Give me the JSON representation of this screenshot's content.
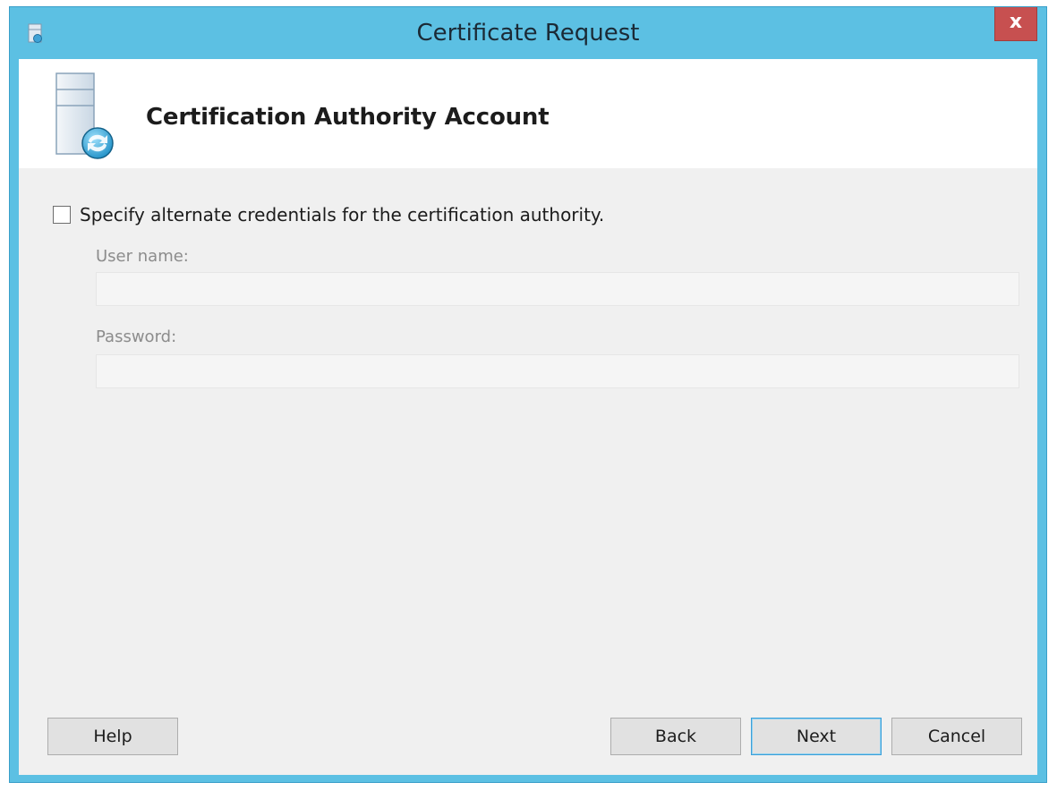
{
  "window": {
    "title": "Certificate Request",
    "close_label": "x",
    "title_icon": "certificate-app-icon"
  },
  "header": {
    "title": "Certification Authority Account",
    "icon": "server-with-arrows-icon"
  },
  "credentials": {
    "checkbox_label": "Specify alternate credentials for the certification authority.",
    "checked": false,
    "username_label": "User name:",
    "username_value": "",
    "password_label": "Password:",
    "password_value": ""
  },
  "buttons": {
    "help": "Help",
    "back": "Back",
    "next": "Next",
    "cancel": "Cancel"
  },
  "colors": {
    "frame": "#5cc0e3",
    "close_button": "#c75050",
    "default_button_border": "#3c9fd8"
  }
}
